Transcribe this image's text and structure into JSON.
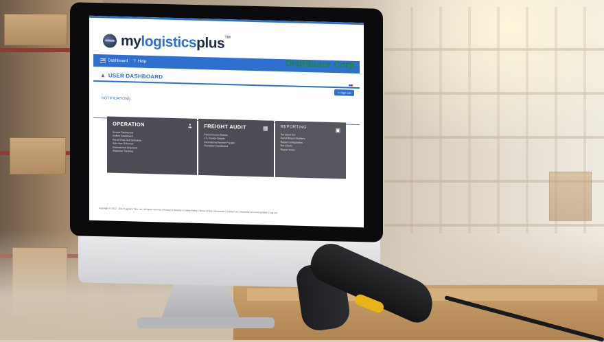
{
  "brand": {
    "my": "my",
    "logistics": "logistics",
    "plus": "plus",
    "tm": "TM",
    "primary_color": "#2e6fd0",
    "dark_color": "#1f2a44"
  },
  "company": {
    "name": "Distributor Corp.",
    "color": "#1f8a2b"
  },
  "nav": {
    "dashboard": "Dashboard",
    "help": "Help",
    "help_icon": "?"
  },
  "dashboard": {
    "title": "USER DASHBOARD",
    "signout": "Sign out",
    "notifications": "NOTIFICATIONS"
  },
  "cards": {
    "operation": {
      "title": "OPERATION",
      "items": [
        "Invoice Dashboard",
        "Orders Dashboard",
        "Parcel Rate And Schedule",
        "Auto Ape Schedule",
        "International Shipment",
        "Shipment Tracking"
      ]
    },
    "freight_audit": {
      "title": "FREIGHT AUDIT",
      "items": [
        "Parcel Invoice Details",
        "LTL Invoice Details",
        "International Invoice Freight",
        "Reception Dashboard"
      ]
    },
    "reporting": {
      "title": "REPORTING",
      "items": [
        "Set report list",
        "Saved Report Builders",
        "Report configuration",
        "Bar Charts",
        "Report Writer"
      ]
    }
  },
  "footer": {
    "copyright": "Copyright © 2012 - 2022 Logistics Plus, Inc. All rights reserved | Privacy & Security | Cookie Policy | Terms of Use | Disclaimer | Contact Us | Subscribe to e-mail updates | Log out"
  }
}
